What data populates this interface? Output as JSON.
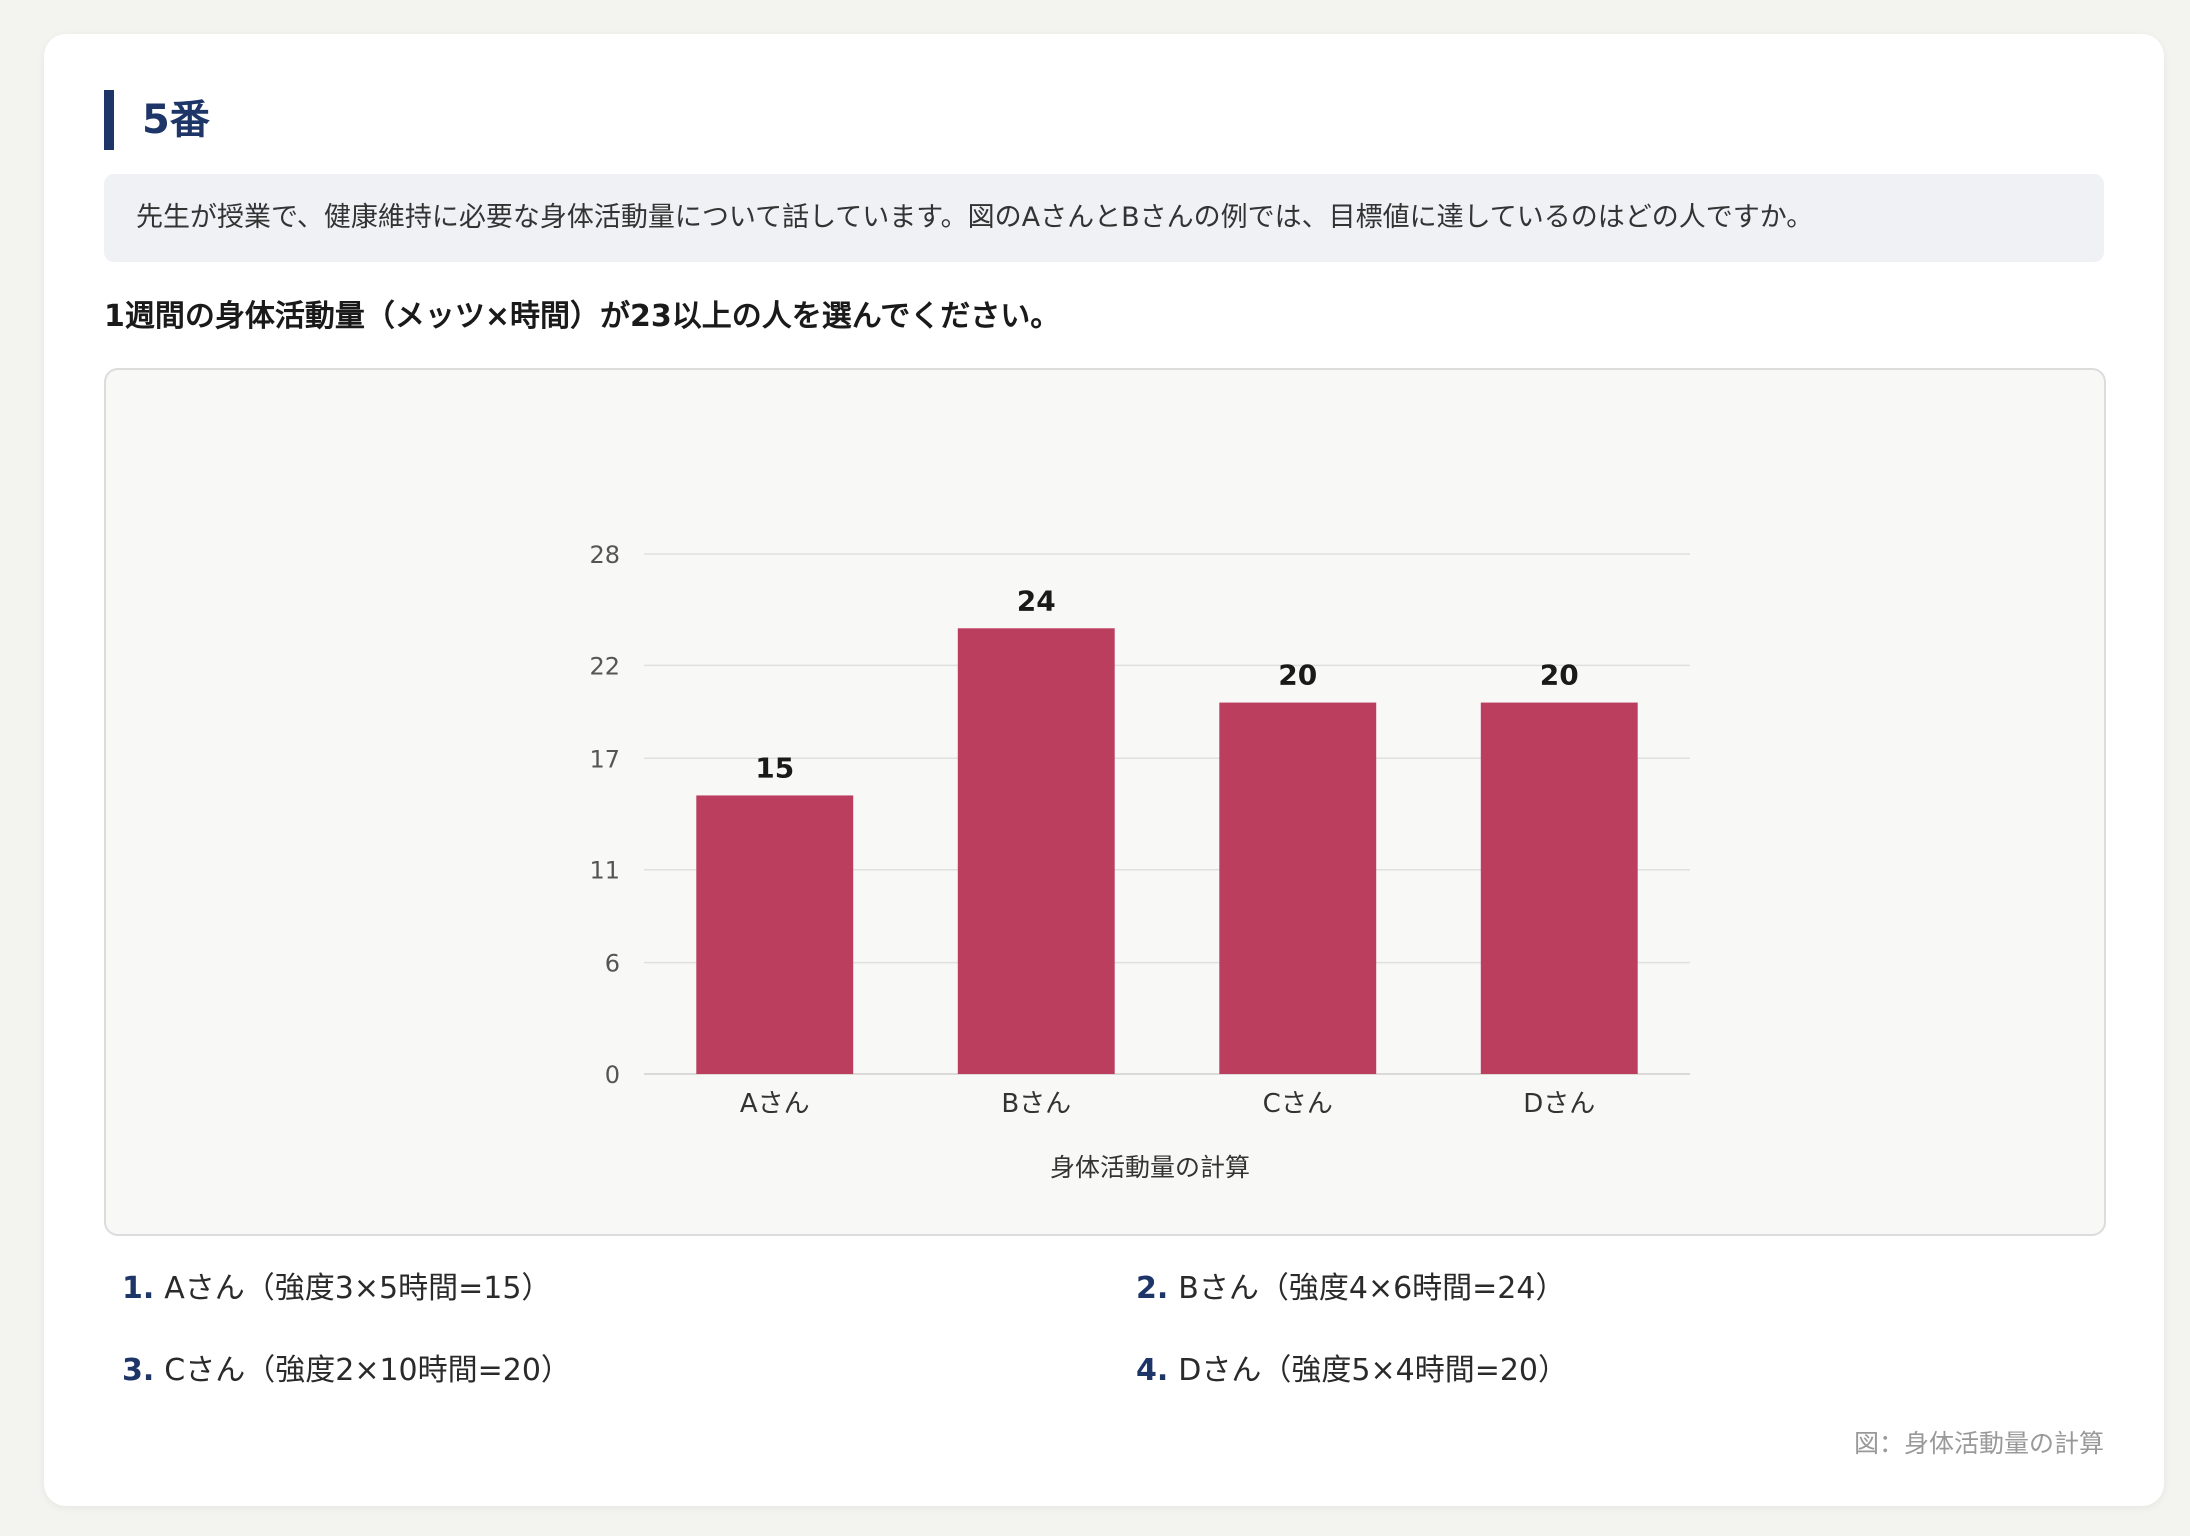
{
  "heading": "5番",
  "prompt": "先生が授業で、健康維持に必要な身体活動量について話しています。図のAさんとBさんの例では、目標値に達しているのはどの人ですか。",
  "question": "1週間の身体活動量（メッツ×時間）が23以上の人を選んでください。",
  "options": [
    {
      "num": "1.",
      "text": "Aさん（強度3×5時間=15）"
    },
    {
      "num": "2.",
      "text": "Bさん（強度4×6時間=24）"
    },
    {
      "num": "3.",
      "text": "Cさん（強度2×10時間=20）"
    },
    {
      "num": "4.",
      "text": "Dさん（強度5×4時間=20）"
    }
  ],
  "caption": "図：身体活動量の計算",
  "colors": {
    "accent": "#1e3568",
    "bar": "#bc3e5f"
  },
  "chart_data": {
    "type": "bar",
    "categories": [
      "Aさん",
      "Bさん",
      "Cさん",
      "Dさん"
    ],
    "values": [
      15,
      24,
      20,
      20
    ],
    "title": "",
    "xlabel": "身体活動量の計算",
    "ylabel": "",
    "yticks": [
      0,
      6,
      11,
      17,
      22,
      28
    ],
    "ylim": [
      0,
      28
    ],
    "grid": true,
    "data_labels": true
  }
}
